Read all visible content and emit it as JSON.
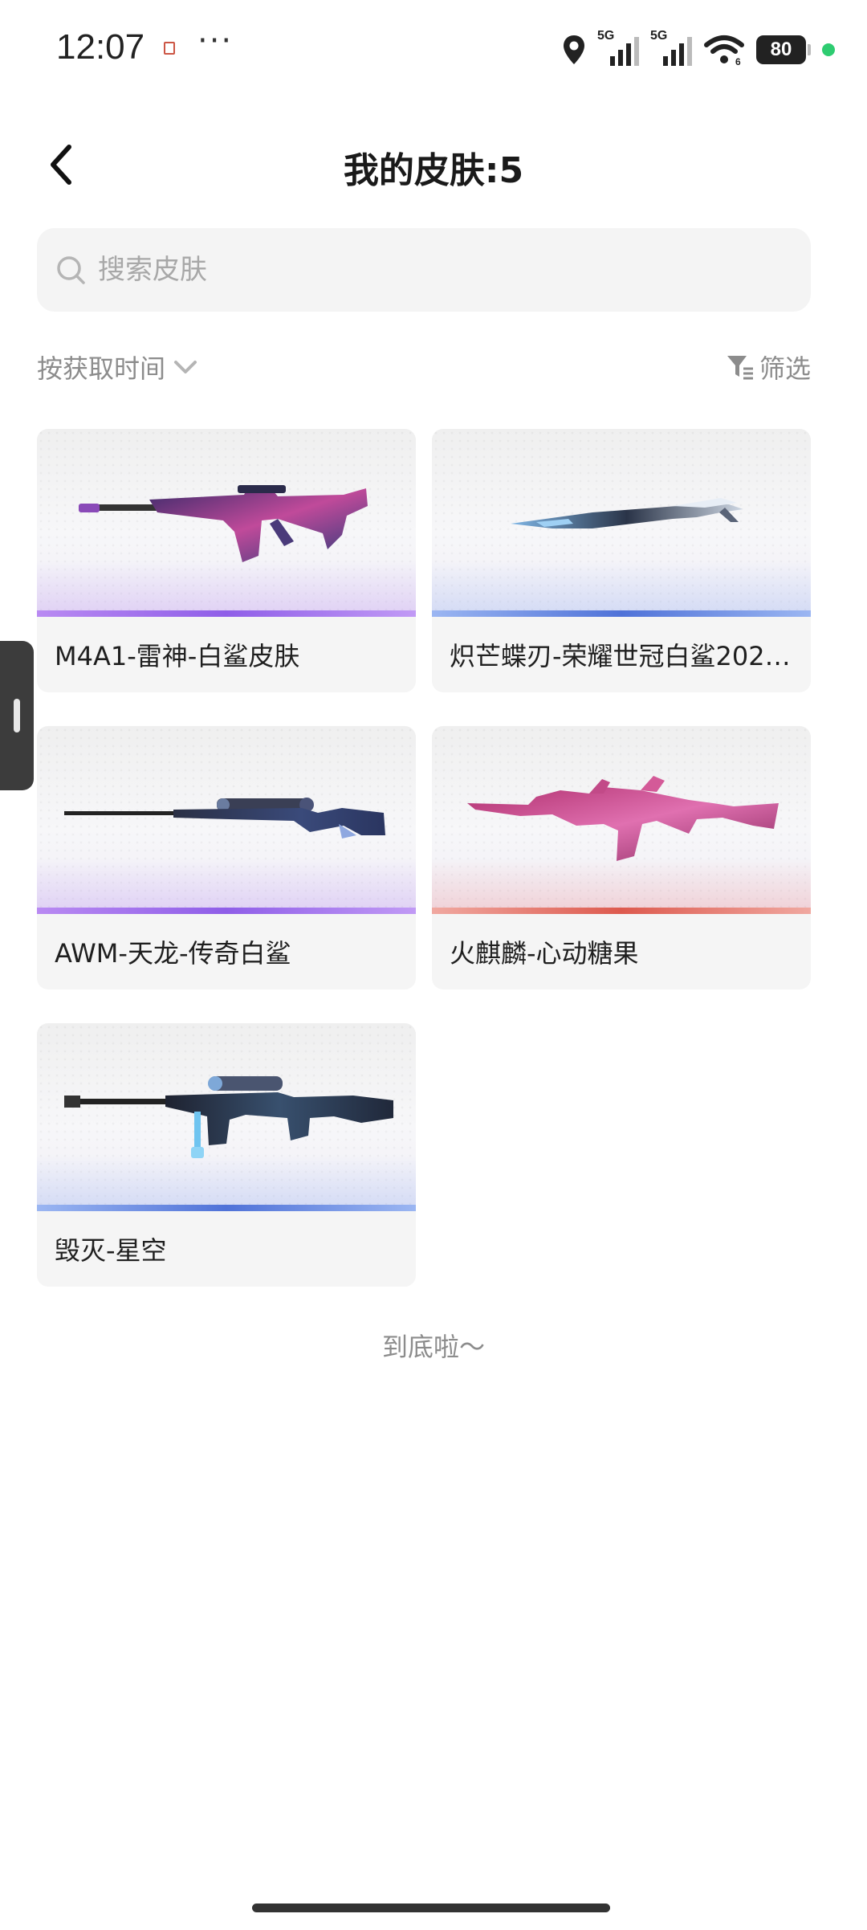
{
  "status_bar": {
    "time": "12:07",
    "more": "···",
    "signal1_label": "5G",
    "signal2_label": "5G",
    "battery": "80",
    "icons": [
      "location-icon",
      "signal-icon",
      "signal-icon",
      "wifi-icon",
      "battery-icon"
    ]
  },
  "header": {
    "title": "我的皮肤:5"
  },
  "search": {
    "placeholder": "搜索皮肤",
    "value": ""
  },
  "sort": {
    "label": "按获取时间"
  },
  "filter": {
    "label": "筛选"
  },
  "skins": [
    {
      "name": "M4A1-雷神-白鲨皮肤",
      "rarity_color": "#9b6bee",
      "icon": "rifle-image"
    },
    {
      "name": "炽芒蝶刃-荣耀世冠白鲨202…",
      "rarity_color": "#4f72d8",
      "icon": "knife-image"
    },
    {
      "name": "AWM-天龙-传奇白鲨",
      "rarity_color": "#9b6bee",
      "icon": "sniper-image"
    },
    {
      "name": "火麒麟-心动糖果",
      "rarity_color": "#dd5a4e",
      "icon": "ak-image"
    },
    {
      "name": "毁灭-星空",
      "rarity_color": "#4f72d8",
      "icon": "heavy-sniper-image"
    }
  ],
  "footer": {
    "end_text": "到底啦～"
  }
}
